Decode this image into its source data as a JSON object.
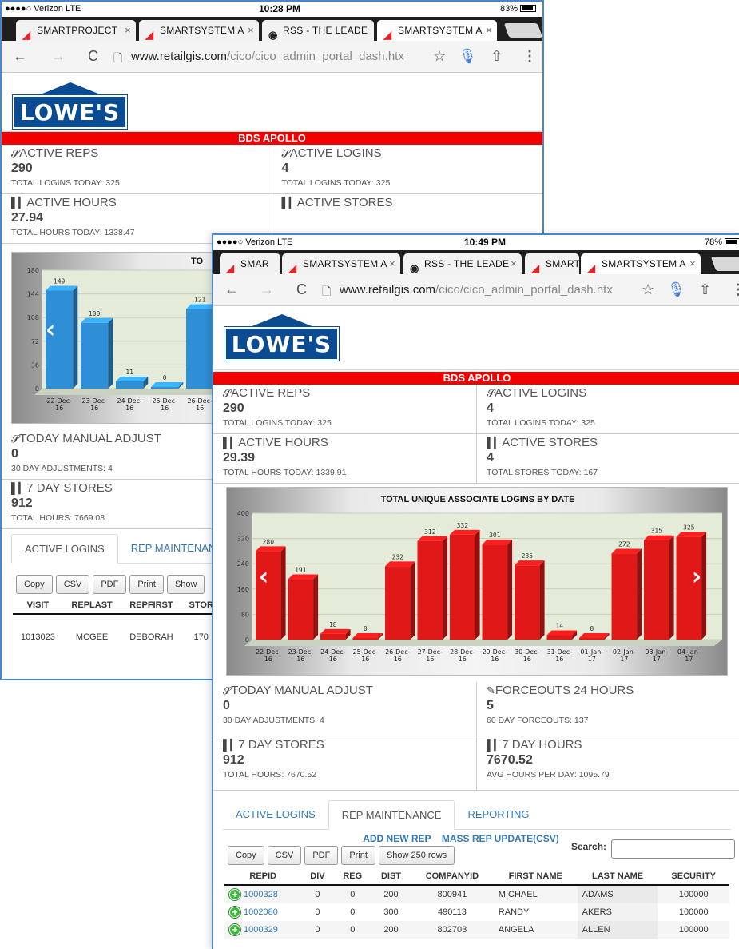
{
  "back": {
    "status": {
      "carrier": "●●●●○ Verizon  LTE",
      "time": "10:28 PM",
      "battery": "83%"
    },
    "tabs": [
      {
        "title": "SMARTPROJECT"
      },
      {
        "title": "SMARTSYSTEM A"
      },
      {
        "title": "RSS - THE LEADE"
      },
      {
        "title": "SMARTSYSTEM A"
      }
    ],
    "url": {
      "domain": "www.retailgis.com",
      "path": "/cico/cico_admin_portal_dash.htx"
    },
    "logo": "LOWE'S",
    "banner": "BDS APOLLO",
    "stats": [
      {
        "label": "ACTIVE REPS",
        "value": "290",
        "sub": "TOTAL LOGINS TODAY: 325"
      },
      {
        "label": "ACTIVE LOGINS",
        "value": "4",
        "sub": "TOTAL LOGINS TODAY: 325"
      },
      {
        "label": "ACTIVE HOURS",
        "value": "27.94",
        "sub": "TOTAL HOURS TODAY: 1338.47"
      },
      {
        "label": "ACTIVE STORES",
        "value": "",
        "sub": ""
      }
    ],
    "chart_title_partial": "TO",
    "stats2": [
      {
        "label": "TODAY MANUAL ADJUST",
        "value": "0",
        "sub": "30 DAY ADJUSTMENTS: 4"
      },
      {
        "label": "7 DAY STORES",
        "value": "912",
        "sub": "TOTAL HOURS: 7669.08"
      }
    ],
    "tabs_bottom": [
      "ACTIVE LOGINS",
      "REP MAINTENANC"
    ],
    "buttons": [
      "Copy",
      "CSV",
      "PDF",
      "Print",
      "Show"
    ],
    "table": {
      "headers": [
        "VISIT",
        "REPLAST",
        "REPFIRST",
        "STOR"
      ],
      "rows": [
        [
          "1013023",
          "MCGEE",
          "DEBORAH",
          "170"
        ]
      ]
    }
  },
  "front": {
    "status": {
      "carrier": "●●●●○ Verizon  LTE",
      "time": "10:49 PM",
      "battery": "78%"
    },
    "tabs": [
      {
        "title": "SMAR"
      },
      {
        "title": "SMARTSYSTEM A"
      },
      {
        "title": "RSS - THE LEADE"
      },
      {
        "title": "SMART"
      },
      {
        "title": "SMARTSYSTEM A"
      }
    ],
    "url": {
      "domain": "www.retailgis.com",
      "path": "/cico/cico_admin_portal_dash.htx"
    },
    "logo": "LOWE'S",
    "banner": "BDS APOLLO",
    "stats": [
      {
        "label": "ACTIVE REPS",
        "value": "290",
        "sub": "TOTAL LOGINS TODAY: 325"
      },
      {
        "label": "ACTIVE LOGINS",
        "value": "4",
        "sub": "TOTAL LOGINS TODAY: 325"
      },
      {
        "label": "ACTIVE HOURS",
        "value": "29.39",
        "sub": "TOTAL HOURS TODAY: 1339.91"
      },
      {
        "label": "ACTIVE STORES",
        "value": "4",
        "sub": "TOTAL STORES TODAY: 167"
      }
    ],
    "stats2": [
      {
        "label": "TODAY MANUAL ADJUST",
        "value": "0",
        "sub": "30 DAY ADJUSTMENTS: 4"
      },
      {
        "label": "FORCEOUTS 24 HOURS",
        "value": "5",
        "sub": "60 DAY FORCEOUTS: 137"
      },
      {
        "label": "7 DAY STORES",
        "value": "912",
        "sub": "TOTAL HOURS: 7670.52"
      },
      {
        "label": "7 DAY HOURS",
        "value": "7670.52",
        "sub": "AVG HOURS PER DAY: 1095.79"
      }
    ],
    "tabs_bottom": [
      "ACTIVE LOGINS",
      "REP MAINTENANCE",
      "REPORTING"
    ],
    "links": [
      "ADD NEW REP",
      "MASS REP UPDATE(CSV)"
    ],
    "buttons": [
      "Copy",
      "CSV",
      "PDF",
      "Print",
      "Show 250 rows"
    ],
    "search_label": "Search:",
    "table": {
      "headers": [
        "REPID",
        "DIV",
        "REG",
        "DIST",
        "COMPANYID",
        "FIRST NAME",
        "LAST NAME",
        "SECURITY"
      ],
      "rows": [
        [
          "1000328",
          "0",
          "0",
          "200",
          "800941",
          "MICHAEL",
          "ADAMS",
          "100000"
        ],
        [
          "1002080",
          "0",
          "0",
          "300",
          "490113",
          "RANDY",
          "AKERS",
          "100000"
        ],
        [
          "1000329",
          "0",
          "0",
          "200",
          "802703",
          "ANGELA",
          "ALLEN",
          "100000"
        ]
      ]
    }
  },
  "chart_data": [
    {
      "type": "bar",
      "title": "TO",
      "categories": [
        "22-Dec-16",
        "23-Dec-16",
        "24-Dec-16",
        "25-Dec-16",
        "26-Dec-16"
      ],
      "values": [
        149,
        100,
        11,
        0,
        121
      ],
      "ylim": [
        0,
        180
      ],
      "yticks": [
        0,
        36,
        72,
        108,
        144,
        180
      ],
      "color": "#2f8fd6"
    },
    {
      "type": "bar",
      "title": "TOTAL UNIQUE ASSOCIATE LOGINS BY DATE",
      "categories": [
        "22-Dec-16",
        "23-Dec-16",
        "24-Dec-16",
        "25-Dec-16",
        "26-Dec-16",
        "27-Dec-16",
        "28-Dec-16",
        "29-Dec-16",
        "30-Dec-16",
        "31-Dec-16",
        "01-Jan-17",
        "02-Jan-17",
        "03-Jan-17",
        "04-Jan-17"
      ],
      "values": [
        280,
        191,
        18,
        0,
        232,
        312,
        332,
        301,
        235,
        14,
        0,
        272,
        315,
        325
      ],
      "ylim": [
        0,
        400
      ],
      "yticks": [
        0,
        80,
        160,
        240,
        320,
        400
      ],
      "color": "#e01818"
    }
  ]
}
